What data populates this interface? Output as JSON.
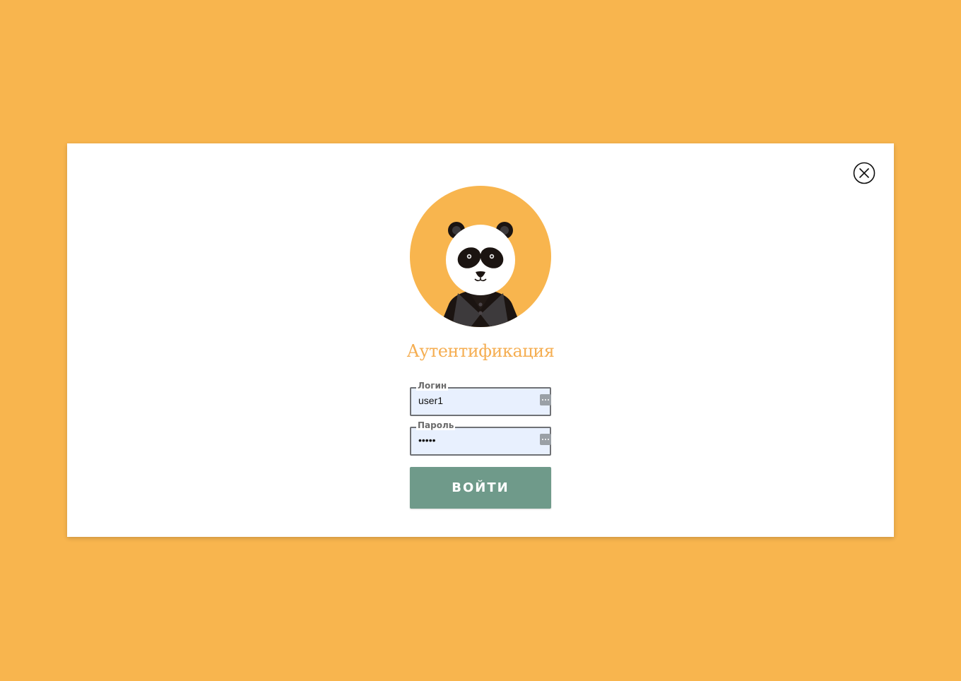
{
  "modal": {
    "title": "Аутентификация",
    "close_icon": "close-circle-icon",
    "avatar_icon": "panda-avatar-icon"
  },
  "login": {
    "legend": "Логин",
    "value": "user1",
    "icon": "password-manager-icon"
  },
  "password": {
    "legend": "Пароль",
    "value": "•••••",
    "icon": "password-manager-icon"
  },
  "submit": {
    "label": "ВОЙТИ"
  },
  "colors": {
    "background": "#F8B54E",
    "title": "#F5AE52",
    "button": "#6F9A8A",
    "input_autofill": "#E8F0FE"
  }
}
